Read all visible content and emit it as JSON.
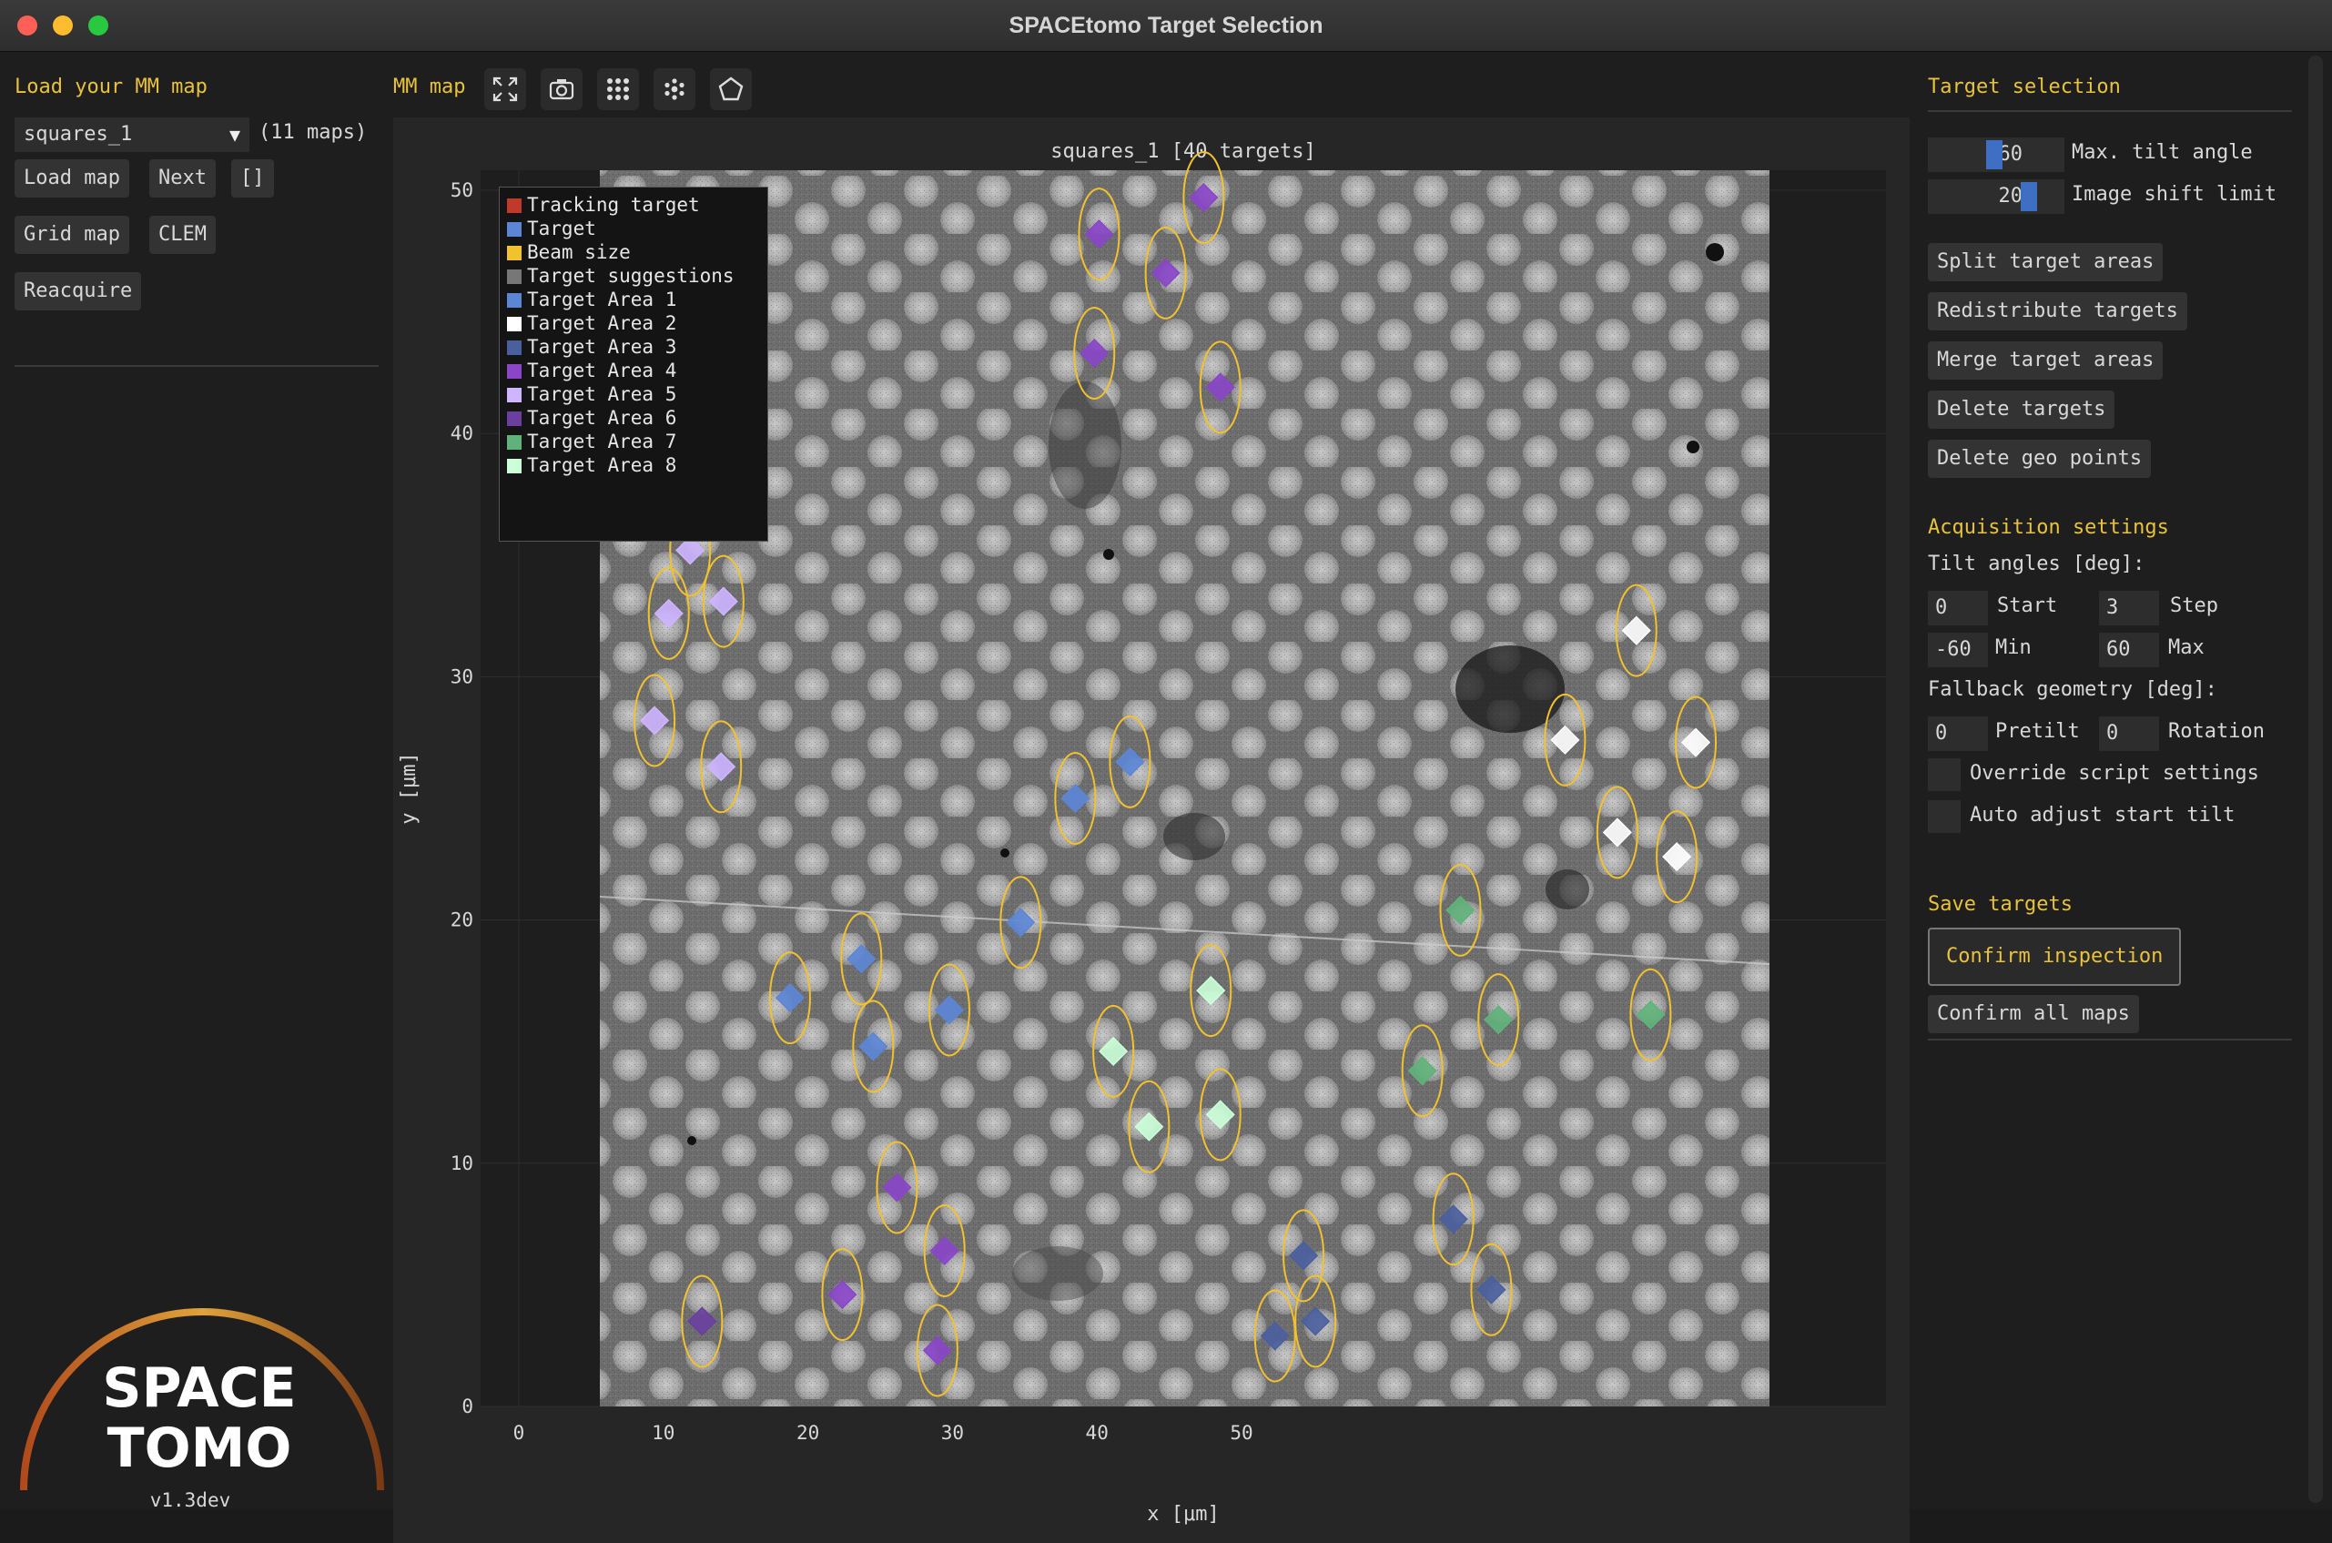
{
  "window": {
    "title": "SPACEtomo Target Selection"
  },
  "left": {
    "heading": "Load your MM map",
    "map_select": "squares_1",
    "map_count": "(11 maps)",
    "buttons": {
      "load_map": "Load map",
      "next": "Next",
      "brackets": "[]",
      "grid_map": "Grid map",
      "clem": "CLEM",
      "reacquire": "Reacquire"
    },
    "logo": {
      "line1": "SPACE",
      "line2": "TOMO",
      "version": "v1.3dev"
    }
  },
  "center": {
    "label": "MM map",
    "tools": [
      "fullscreen-icon",
      "camera-icon",
      "grid-dots-icon",
      "cluster-icon",
      "pentagon-icon"
    ],
    "plot_title": "squares_1 [40 targets]",
    "xlabel": "x [μm]",
    "ylabel": "y [μm]",
    "xticks": [
      "0",
      "10",
      "20",
      "30",
      "40",
      "50"
    ],
    "yticks": [
      "0",
      "10",
      "20",
      "30",
      "40",
      "50"
    ],
    "legend": [
      {
        "label": "Tracking target",
        "color": "#c0392b"
      },
      {
        "label": "Target",
        "color": "#5b86d6"
      },
      {
        "label": "Beam size",
        "color": "#f2c12e"
      },
      {
        "label": "Target suggestions",
        "color": "#777777"
      },
      {
        "label": "Target Area 1",
        "color": "#5b86d6"
      },
      {
        "label": "Target Area 2",
        "color": "#ffffff"
      },
      {
        "label": "Target Area 3",
        "color": "#4a5f9e"
      },
      {
        "label": "Target Area 4",
        "color": "#8a45c8"
      },
      {
        "label": "Target Area 5",
        "color": "#cdb5ff"
      },
      {
        "label": "Target Area 6",
        "color": "#6a3fa0"
      },
      {
        "label": "Target Area 7",
        "color": "#5fb37a"
      },
      {
        "label": "Target Area 8",
        "color": "#cbffd8"
      }
    ]
  },
  "chart_data": {
    "type": "scatter",
    "title": "squares_1 [40 targets]",
    "xlabel": "x [μm]",
    "ylabel": "y [μm]",
    "xlim": [
      -5,
      54
    ],
    "ylim": [
      0,
      52.5
    ],
    "series": [
      {
        "name": "Target Area 1",
        "color": "#5b86d6",
        "points": [
          [
            8,
            16.8
          ],
          [
            11,
            18.4
          ],
          [
            11.5,
            14.8
          ],
          [
            14.7,
            16.3
          ],
          [
            17.7,
            19.9
          ],
          [
            20,
            25
          ],
          [
            22.3,
            26.5
          ]
        ]
      },
      {
        "name": "Target Area 2",
        "color": "#ffffff",
        "points": [
          [
            40.6,
            27.4
          ],
          [
            43.6,
            31.9
          ],
          [
            46.1,
            27.3
          ],
          [
            42.8,
            23.6
          ],
          [
            45.3,
            22.6
          ]
        ]
      },
      {
        "name": "Target Area 3",
        "color": "#4a5f9e",
        "points": [
          [
            28.4,
            2.9
          ],
          [
            29.6,
            6.2
          ],
          [
            30.1,
            3.5
          ],
          [
            35.9,
            7.7
          ],
          [
            37.5,
            4.8
          ]
        ]
      },
      {
        "name": "Target Area 4",
        "color": "#8a45c8",
        "points": [
          [
            21,
            48.2
          ],
          [
            25.4,
            49.7
          ],
          [
            23.8,
            46.6
          ],
          [
            20.8,
            43.3
          ],
          [
            26.1,
            41.9
          ],
          [
            12.5,
            9
          ],
          [
            14.5,
            6.4
          ],
          [
            10.2,
            4.6
          ],
          [
            14.2,
            2.3
          ]
        ]
      },
      {
        "name": "Target Area 5",
        "color": "#cdb5ff",
        "points": [
          [
            3.8,
            35.2
          ],
          [
            5.2,
            33.1
          ],
          [
            2.9,
            32.6
          ],
          [
            2.3,
            28.2
          ],
          [
            5.1,
            26.3
          ]
        ]
      },
      {
        "name": "Target Area 6",
        "color": "#6a3fa0",
        "points": [
          [
            4.3,
            3.5
          ]
        ]
      },
      {
        "name": "Target Area 7",
        "color": "#5fb37a",
        "points": [
          [
            36.2,
            20.4
          ],
          [
            37.8,
            15.9
          ],
          [
            44.2,
            16.1
          ],
          [
            34.6,
            13.8
          ]
        ]
      },
      {
        "name": "Target Area 8",
        "color": "#cbffd8",
        "points": [
          [
            25.7,
            17.1
          ],
          [
            21.6,
            14.6
          ],
          [
            23.1,
            11.5
          ],
          [
            26.1,
            12
          ]
        ]
      }
    ]
  },
  "right": {
    "heading": "Target selection",
    "max_tilt": {
      "value": "60",
      "fill": 0.6,
      "label": "Max. tilt angle"
    },
    "shift_limit": {
      "value": "20",
      "fill": 0.98,
      "label": "Image shift limit"
    },
    "buttons": [
      "Split target areas",
      "Redistribute targets",
      "Merge target areas",
      "Delete targets",
      "Delete geo points"
    ],
    "acq_heading": "Acquisition settings",
    "tilt_label": "Tilt angles [deg]:",
    "start": {
      "value": "0",
      "label": "Start"
    },
    "step": {
      "value": "3",
      "label": "Step"
    },
    "min": {
      "value": "-60",
      "label": "Min"
    },
    "max": {
      "value": "60",
      "label": "Max"
    },
    "fallback_label": "Fallback geometry [deg]:",
    "pretilt": {
      "value": "0",
      "label": "Pretilt"
    },
    "rotation": {
      "value": "0",
      "label": "Rotation"
    },
    "override": "Override script settings",
    "autoadjust": "Auto adjust start tilt",
    "save_heading": "Save targets",
    "confirm_inspection": "Confirm inspection",
    "confirm_all": "Confirm all maps"
  }
}
